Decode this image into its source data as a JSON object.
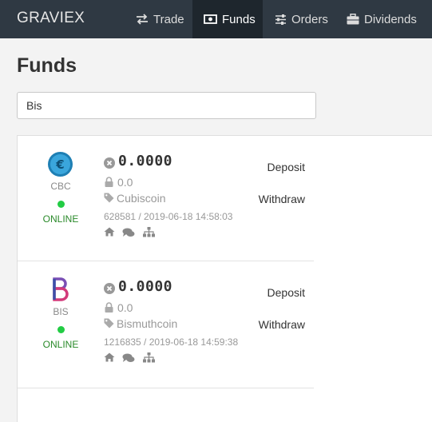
{
  "app": {
    "brand": "GRAVIEX"
  },
  "nav": {
    "trade": {
      "label": "Trade",
      "icon": "exchange-icon"
    },
    "funds": {
      "label": "Funds",
      "icon": "money-icon"
    },
    "orders": {
      "label": "Orders",
      "icon": "sliders-icon"
    },
    "dividends": {
      "label": "Dividends",
      "icon": "briefcase-icon"
    },
    "active": "funds"
  },
  "page": {
    "title": "Funds"
  },
  "search": {
    "value": "Bis",
    "placeholder": ""
  },
  "coins": [
    {
      "symbol": "CBC",
      "name": "Cubiscoin",
      "status": "ONLINE",
      "balance": "0.0000",
      "locked": "0.0",
      "meta": "628581 / 2019-06-18 14:58:03",
      "deposit": "Deposit",
      "withdraw": "Withdraw",
      "logo_color": "#1e7fb4"
    },
    {
      "symbol": "BIS",
      "name": "Bismuthcoin",
      "status": "ONLINE",
      "balance": "0.0000",
      "locked": "0.0",
      "meta": "1216835 / 2019-06-18 14:59:38",
      "deposit": "Deposit",
      "withdraw": "Withdraw",
      "logo_color": "#6a3fa0"
    }
  ],
  "colors": {
    "navbar": "#2f3943",
    "navbar_active": "#1e262d",
    "online": "#22cc44",
    "online_text": "#2a8a2a"
  }
}
